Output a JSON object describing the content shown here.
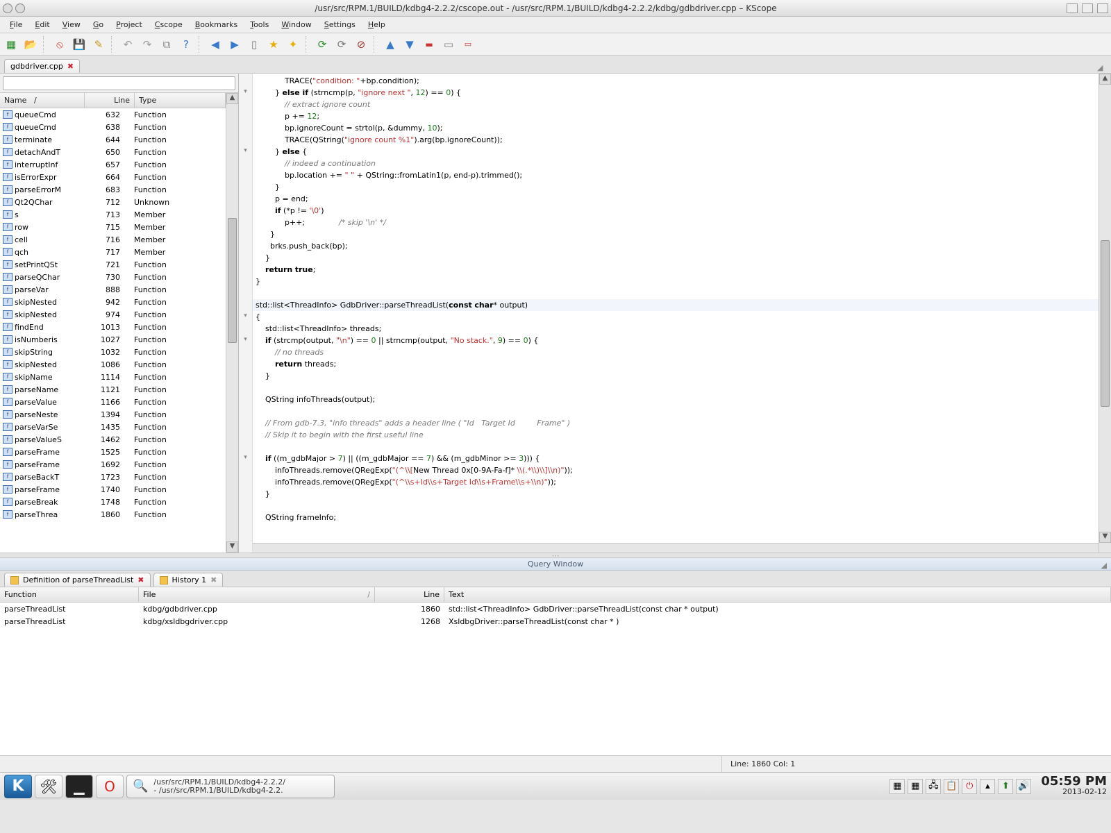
{
  "window": {
    "title": "/usr/src/RPM.1/BUILD/kdbg4-2.2.2/cscope.out - /usr/src/RPM.1/BUILD/kdbg4-2.2.2/kdbg/gdbdriver.cpp – KScope"
  },
  "menu": [
    "File",
    "Edit",
    "View",
    "Go",
    "Project",
    "Cscope",
    "Bookmarks",
    "Tools",
    "Window",
    "Settings",
    "Help"
  ],
  "editor_tab": {
    "label": "gdbdriver.cpp"
  },
  "symbol_table": {
    "headers": {
      "name": "Name",
      "line": "Line",
      "type": "Type"
    },
    "rows": [
      {
        "name": "queueCmd",
        "line": 632,
        "type": "Function"
      },
      {
        "name": "queueCmd",
        "line": 638,
        "type": "Function"
      },
      {
        "name": "terminate",
        "line": 644,
        "type": "Function"
      },
      {
        "name": "detachAndT",
        "line": 650,
        "type": "Function"
      },
      {
        "name": "interruptInf",
        "line": 657,
        "type": "Function"
      },
      {
        "name": "isErrorExpr",
        "line": 664,
        "type": "Function"
      },
      {
        "name": "parseErrorM",
        "line": 683,
        "type": "Function"
      },
      {
        "name": "Qt2QChar",
        "line": 712,
        "type": "Unknown"
      },
      {
        "name": "s",
        "line": 713,
        "type": "Member"
      },
      {
        "name": "row",
        "line": 715,
        "type": "Member"
      },
      {
        "name": "cell",
        "line": 716,
        "type": "Member"
      },
      {
        "name": "qch",
        "line": 717,
        "type": "Member"
      },
      {
        "name": "setPrintQSt",
        "line": 721,
        "type": "Function"
      },
      {
        "name": "parseQChar",
        "line": 730,
        "type": "Function"
      },
      {
        "name": "parseVar",
        "line": 888,
        "type": "Function"
      },
      {
        "name": "skipNested",
        "line": 942,
        "type": "Function"
      },
      {
        "name": "skipNested",
        "line": 974,
        "type": "Function"
      },
      {
        "name": "findEnd",
        "line": 1013,
        "type": "Function"
      },
      {
        "name": "isNumberis",
        "line": 1027,
        "type": "Function"
      },
      {
        "name": "skipString",
        "line": 1032,
        "type": "Function"
      },
      {
        "name": "skipNested",
        "line": 1086,
        "type": "Function"
      },
      {
        "name": "skipName",
        "line": 1114,
        "type": "Function"
      },
      {
        "name": "parseName",
        "line": 1121,
        "type": "Function"
      },
      {
        "name": "parseValue",
        "line": 1166,
        "type": "Function"
      },
      {
        "name": "parseNeste",
        "line": 1394,
        "type": "Function"
      },
      {
        "name": "parseVarSe",
        "line": 1435,
        "type": "Function"
      },
      {
        "name": "parseValueS",
        "line": 1462,
        "type": "Function"
      },
      {
        "name": "parseFrame",
        "line": 1525,
        "type": "Function"
      },
      {
        "name": "parseFrame",
        "line": 1692,
        "type": "Function"
      },
      {
        "name": "parseBackT",
        "line": 1723,
        "type": "Function"
      },
      {
        "name": "parseFrame",
        "line": 1740,
        "type": "Function"
      },
      {
        "name": "parseBreak",
        "line": 1748,
        "type": "Function"
      },
      {
        "name": "parseThrea",
        "line": 1860,
        "type": "Function"
      }
    ]
  },
  "code": {
    "lines": [
      {
        "i": "            TRACE(<s>\"condition: \"</s>+bp.condition);"
      },
      {
        "i": "        } <k>else if</k> (strncmp(p, <s>\"ignore next \"</s>, <n>12</n>) == <n>0</n>) {",
        "fold": "v"
      },
      {
        "i": "            <c>// extract ignore count</c>"
      },
      {
        "i": "            p += <n>12</n>;"
      },
      {
        "i": "            bp.ignoreCount = strtol(p, &dummy, <n>10</n>);"
      },
      {
        "i": "            TRACE(QString(<s>\"ignore count %1\"</s>).arg(bp.ignoreCount));"
      },
      {
        "i": "        } <k>else</k> {",
        "fold": "v"
      },
      {
        "i": "            <c>// indeed a continuation</c>"
      },
      {
        "i": "            bp.location += <s>\" \"</s> + QString::fromLatin1(p, end-p).trimmed();"
      },
      {
        "i": "        }"
      },
      {
        "i": "        p = end;"
      },
      {
        "i": "        <k>if</k> (*p != <s>'\\0'</s>)"
      },
      {
        "i": "            p++;              <c>/* skip '\\n' */</c>"
      },
      {
        "i": "      }"
      },
      {
        "i": "      brks.push_back(bp);"
      },
      {
        "i": "    }"
      },
      {
        "i": "    <k>return</k> <k>true</k>;"
      },
      {
        "i": "}"
      },
      {
        "i": ""
      },
      {
        "i": "std::list<ThreadInfo> GdbDriver::parseThreadList(<k>const</k> <k>char</k>* output)",
        "hl": true
      },
      {
        "i": "{",
        "fold": "v"
      },
      {
        "i": "    std::list<ThreadInfo> threads;"
      },
      {
        "i": "    <k>if</k> (strcmp(output, <s>\"\\n\"</s>) == <n>0</n> || strncmp(output, <s>\"No stack.\"</s>, <n>9</n>) == <n>0</n>) {",
        "fold": "v"
      },
      {
        "i": "        <c>// no threads</c>"
      },
      {
        "i": "        <k>return</k> threads;"
      },
      {
        "i": "    }"
      },
      {
        "i": ""
      },
      {
        "i": "    QString infoThreads(output);"
      },
      {
        "i": ""
      },
      {
        "i": "    <c>// From gdb-7.3, \"info threads\" adds a header line ( \"Id   Target Id         Frame\" )</c>"
      },
      {
        "i": "    <c>// Skip it to begin with the first useful line</c>"
      },
      {
        "i": ""
      },
      {
        "i": "    <k>if</k> ((m_gdbMajor > <n>7</n>) || ((m_gdbMajor == <n>7</n>) && (m_gdbMinor >= <n>3</n>))) {",
        "fold": "v"
      },
      {
        "i": "        infoThreads.remove(QRegExp(<s>\"(^\\\\[</s>New Thread 0x[0-9A-Fa-f]*<s> \\\\(.*\\\\)\\\\]\\\\n)\"</s>));"
      },
      {
        "i": "        infoThreads.remove(QRegExp(<s>\"(^\\\\s+Id\\\\s+Target Id\\\\s+Frame\\\\s+\\\\n)\"</s>));"
      },
      {
        "i": "    }"
      },
      {
        "i": ""
      },
      {
        "i": "    QString frameInfo;"
      }
    ]
  },
  "query": {
    "title": "Query Window",
    "tabs": [
      {
        "label": "Definition of parseThreadList",
        "closable": true,
        "active": true
      },
      {
        "label": "History 1",
        "closable": true,
        "grey": true
      }
    ],
    "headers": {
      "func": "Function",
      "file": "File",
      "line": "Line",
      "text": "Text"
    },
    "rows": [
      {
        "func": "parseThreadList",
        "file": "kdbg/gdbdriver.cpp",
        "line": 1860,
        "text": "std::list<ThreadInfo> GdbDriver::parseThreadList(const char * output)"
      },
      {
        "func": "parseThreadList",
        "file": "kdbg/xsldbgdriver.cpp",
        "line": 1268,
        "text": "XsldbgDriver::parseThreadList(const char * )"
      }
    ]
  },
  "status": {
    "pos": "Line: 1860 Col: 1"
  },
  "taskbar": {
    "task": {
      "line1": "/usr/src/RPM.1/BUILD/kdbg4-2.2.2/",
      "line2": "- /usr/src/RPM.1/BUILD/kdbg4-2.2."
    },
    "time": "05:59 PM",
    "date": "2013-02-12"
  }
}
